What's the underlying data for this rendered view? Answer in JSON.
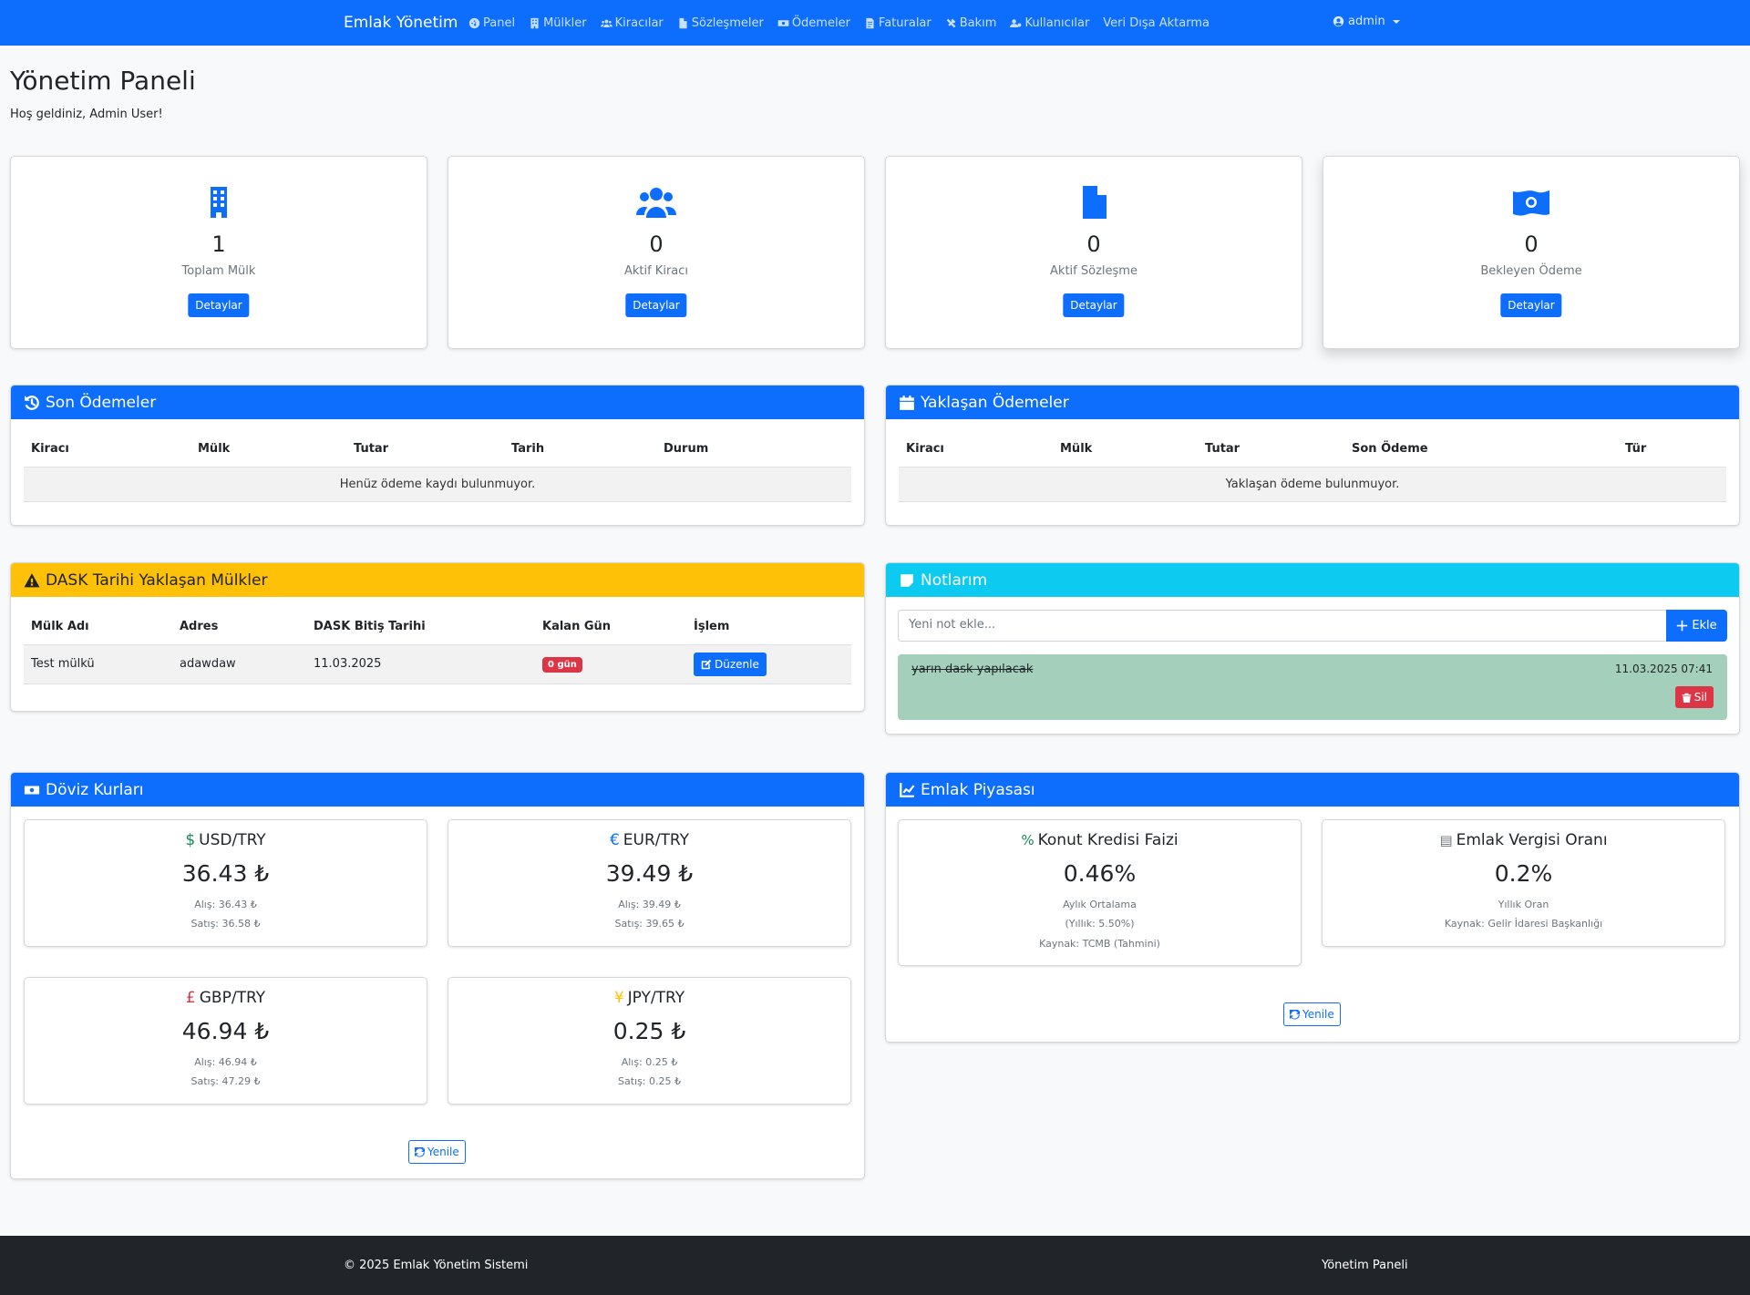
{
  "navbar": {
    "brand": "Emlak Yönetim",
    "links": [
      {
        "label": "Panel",
        "icon": "dashboard-icon"
      },
      {
        "label": "Mülkler",
        "icon": "building-icon"
      },
      {
        "label": "Kiracılar",
        "icon": "users-icon"
      },
      {
        "label": "Sözleşmeler",
        "icon": "file-icon"
      },
      {
        "label": "Ödemeler",
        "icon": "money-icon"
      },
      {
        "label": "Faturalar",
        "icon": "invoice-icon"
      },
      {
        "label": "Bakım",
        "icon": "tools-icon"
      },
      {
        "label": "Kullanıcılar",
        "icon": "user-cog-icon"
      },
      {
        "label": "Veri Dışa Aktarma",
        "icon": ""
      }
    ],
    "user": "admin"
  },
  "header": {
    "title": "Yönetim Paneli",
    "welcome": "Hoş geldiniz, Admin User!"
  },
  "stats": [
    {
      "value": "1",
      "label": "Toplam Mülk",
      "button": "Detaylar",
      "icon": "building-icon"
    },
    {
      "value": "0",
      "label": "Aktif Kiracı",
      "button": "Detaylar",
      "icon": "users-icon"
    },
    {
      "value": "0",
      "label": "Aktif Sözleşme",
      "button": "Detaylar",
      "icon": "contract-icon"
    },
    {
      "value": "0",
      "label": "Bekleyen Ödeme",
      "button": "Detaylar",
      "icon": "money-icon"
    }
  ],
  "recent_payments": {
    "title": "Son Ödemeler",
    "columns": [
      "Kiracı",
      "Mülk",
      "Tutar",
      "Tarih",
      "Durum"
    ],
    "empty": "Henüz ödeme kaydı bulunmuyor."
  },
  "upcoming_payments": {
    "title": "Yaklaşan Ödemeler",
    "columns": [
      "Kiracı",
      "Mülk",
      "Tutar",
      "Son Ödeme",
      "Tür"
    ],
    "empty": "Yaklaşan ödeme bulunmuyor."
  },
  "dask": {
    "title": "DASK Tarihi Yaklaşan Mülkler",
    "columns": [
      "Mülk Adı",
      "Adres",
      "DASK Bitiş Tarihi",
      "Kalan Gün",
      "İşlem"
    ],
    "rows": [
      {
        "name": "Test mülkü",
        "address": "adawdaw",
        "date": "11.03.2025",
        "remaining": "0 gün",
        "action": "Düzenle"
      }
    ]
  },
  "notes": {
    "title": "Notlarım",
    "placeholder": "Yeni not ekle...",
    "add_label": "Ekle",
    "items": [
      {
        "text": "yarın dask yapılacak",
        "date": "11.03.2025 07:41",
        "delete_label": "Sil"
      }
    ]
  },
  "currency": {
    "title": "Döviz Kurları",
    "refresh": "Yenile",
    "rates": [
      {
        "symbol": "$",
        "pair": "USD/TRY",
        "value": "36.43 ₺",
        "buy": "Alış: 36.43 ₺",
        "sell": "Satış: 36.58 ₺",
        "color": "#198754"
      },
      {
        "symbol": "€",
        "pair": "EUR/TRY",
        "value": "39.49 ₺",
        "buy": "Alış: 39.49 ₺",
        "sell": "Satış: 39.65 ₺",
        "color": "#0d6efd"
      },
      {
        "symbol": "£",
        "pair": "GBP/TRY",
        "value": "46.94 ₺",
        "buy": "Alış: 46.94 ₺",
        "sell": "Satış: 47.29 ₺",
        "color": "#dc3545"
      },
      {
        "symbol": "¥",
        "pair": "JPY/TRY",
        "value": "0.25 ₺",
        "buy": "Alış: 0.25 ₺",
        "sell": "Satış: 0.25 ₺",
        "color": "#ffc107"
      }
    ]
  },
  "market": {
    "title": "Emlak Piyasası",
    "refresh": "Yenile",
    "items": [
      {
        "title": "Konut Kredisi Faizi",
        "value": "0.46%",
        "lines": [
          "Aylık Ortalama",
          "(Yıllık: 5.50%)",
          "Kaynak: TCMB (Tahmini)"
        ],
        "icon": "percent-icon"
      },
      {
        "title": "Emlak Vergisi Oranı",
        "value": "0.2%",
        "lines": [
          "Yıllık Oran",
          "Kaynak: Gelir İdaresi Başkanlığı"
        ],
        "icon": "receipt-icon"
      }
    ]
  },
  "footer": {
    "left": "© 2025 Emlak Yönetim Sistemi",
    "right": "Yönetim Paneli"
  },
  "colors": {
    "primary": "#0d6efd",
    "warning": "#ffc107",
    "info": "#0dcaf0",
    "danger": "#dc3545",
    "dark": "#212529"
  }
}
